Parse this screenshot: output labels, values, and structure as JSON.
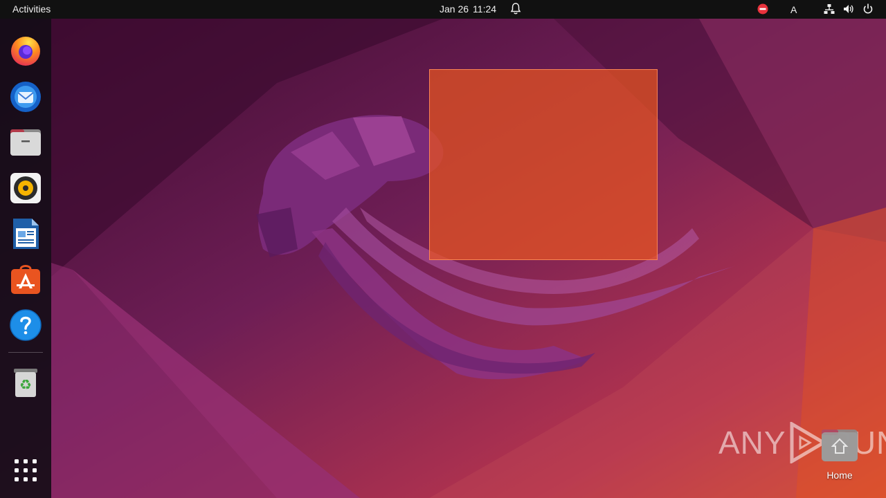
{
  "topbar": {
    "activities_label": "Activities",
    "date": "Jan 26",
    "time": "11:24",
    "keyboard_layout": "A",
    "icons": [
      "notification-bell-icon",
      "do-not-disturb-icon",
      "network-icon",
      "volume-icon",
      "power-icon"
    ]
  },
  "dock": {
    "items": [
      {
        "name": "firefox",
        "icon": "firefox-icon"
      },
      {
        "name": "thunderbird",
        "icon": "thunderbird-icon"
      },
      {
        "name": "files",
        "icon": "files-icon"
      },
      {
        "name": "rhythmbox",
        "icon": "rhythmbox-icon"
      },
      {
        "name": "libreoffice-writer",
        "icon": "writer-icon"
      },
      {
        "name": "app-center",
        "icon": "app-store-icon"
      },
      {
        "name": "help",
        "icon": "help-icon"
      },
      {
        "name": "trash",
        "icon": "trash-icon"
      },
      {
        "name": "show-apps",
        "icon": "app-grid-icon"
      }
    ]
  },
  "desktop": {
    "home_label": "Home",
    "watermark_left": "ANY",
    "watermark_right": "RUN"
  },
  "colors": {
    "topbar_bg": "#111111",
    "selection": "#e95420",
    "wallpaper_base": "#6b1f4f"
  }
}
